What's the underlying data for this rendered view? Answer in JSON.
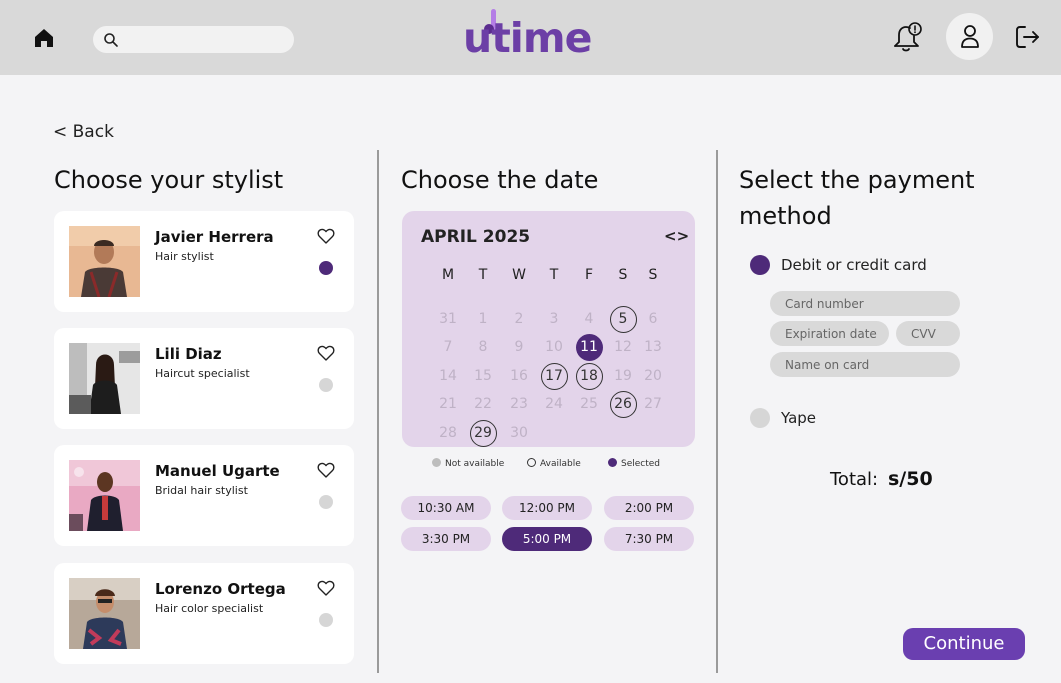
{
  "header": {
    "logo_text": "utime",
    "search_placeholder": ""
  },
  "nav": {
    "back_label": "< Back"
  },
  "stylists": {
    "title": "Choose your stylist",
    "items": [
      {
        "name": "Javier Herrera",
        "role": "Hair stylist",
        "selected": true
      },
      {
        "name": "Lili Diaz",
        "role": "Haircut specialist",
        "selected": false
      },
      {
        "name": "Manuel Ugarte",
        "role": "Bridal hair stylist",
        "selected": false
      },
      {
        "name": "Lorenzo Ortega",
        "role": "Hair color specialist",
        "selected": false
      }
    ]
  },
  "date": {
    "title": "Choose the date",
    "month_label": "APRIL 2025",
    "nav_label": "<>",
    "weekdays": [
      "M",
      "T",
      "W",
      "T",
      "F",
      "S",
      "S"
    ],
    "weeks": [
      [
        "31",
        "1",
        "2",
        "3",
        "4",
        "5",
        "6"
      ],
      [
        "7",
        "8",
        "9",
        "10",
        "11",
        "12",
        "13"
      ],
      [
        "14",
        "15",
        "16",
        "17",
        "18",
        "19",
        "20"
      ],
      [
        "21",
        "22",
        "23",
        "24",
        "25",
        "26",
        "27"
      ],
      [
        "28",
        "29",
        "30"
      ]
    ],
    "available_days": [
      "5",
      "17",
      "18",
      "26",
      "29"
    ],
    "selected_day": "11",
    "legend": {
      "not_available": "Not available",
      "available": "Available",
      "selected": "Selected"
    },
    "times": [
      "10:30 AM",
      "12:00 PM",
      "2:00 PM",
      "3:30 PM",
      "5:00 PM",
      "7:30 PM"
    ],
    "selected_time": "5:00 PM"
  },
  "payment": {
    "title_line1": "Select the payment",
    "title_line2": "method",
    "card_option": "Debit or credit card",
    "card_number_placeholder": "Card number",
    "expiration_placeholder": "Expiration date",
    "cvv_placeholder": "CVV",
    "name_placeholder": "Name on card",
    "yape_option": "Yape",
    "selected_method": "Debit or credit card",
    "total_label": "Total:",
    "total_value": "s/50",
    "continue_label": "Continue"
  },
  "colors": {
    "accent": "#4e2a79",
    "calendar_bg": "#e3d4ea",
    "header_bg": "#d9d9d9",
    "continue_bg": "#6a3fb0"
  }
}
